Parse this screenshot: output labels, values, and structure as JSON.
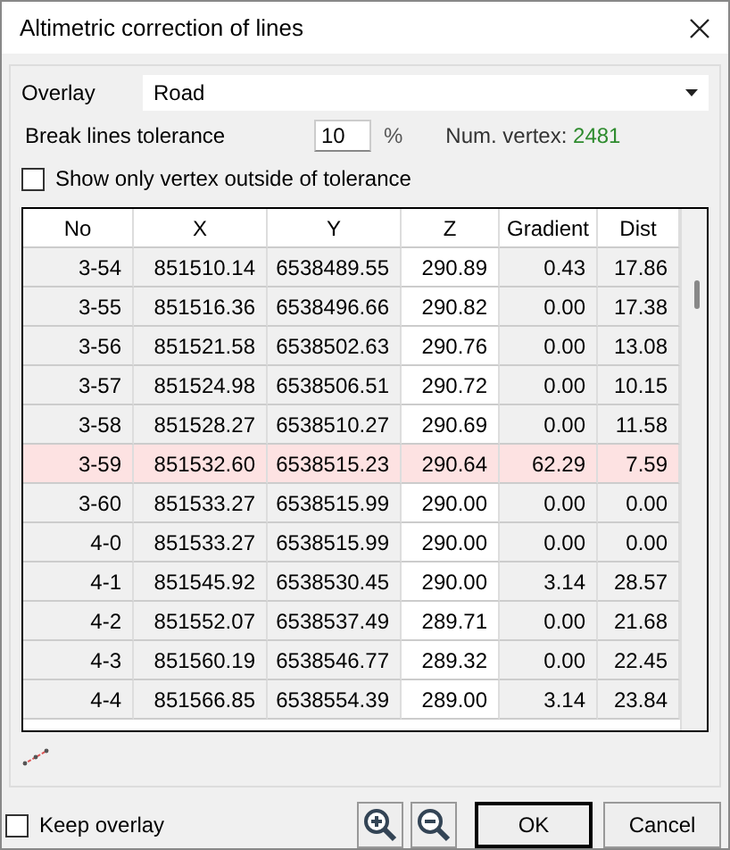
{
  "window": {
    "title": "Altimetric correction of lines"
  },
  "overlay": {
    "label": "Overlay",
    "value": "Road"
  },
  "tolerance": {
    "label": "Break lines tolerance",
    "value": "10",
    "unit": "%"
  },
  "vertex_count": {
    "label": "Num. vertex:",
    "value": "2481"
  },
  "show_outside": {
    "label": "Show only vertex outside of tolerance",
    "checked": false
  },
  "table": {
    "columns": [
      {
        "label": "No",
        "editable": false
      },
      {
        "label": "X",
        "editable": false
      },
      {
        "label": "Y",
        "editable": false
      },
      {
        "label": "Z",
        "editable": true
      },
      {
        "label": "Gradient",
        "editable": false
      },
      {
        "label": "Dist",
        "editable": false
      }
    ],
    "rows": [
      {
        "cells": [
          "3-54",
          "851510.14",
          "6538489.55",
          "290.89",
          "0.43",
          "17.86"
        ],
        "selected": false
      },
      {
        "cells": [
          "3-55",
          "851516.36",
          "6538496.66",
          "290.82",
          "0.00",
          "17.38"
        ],
        "selected": false
      },
      {
        "cells": [
          "3-56",
          "851521.58",
          "6538502.63",
          "290.76",
          "0.00",
          "13.08"
        ],
        "selected": false
      },
      {
        "cells": [
          "3-57",
          "851524.98",
          "6538506.51",
          "290.72",
          "0.00",
          "10.15"
        ],
        "selected": false
      },
      {
        "cells": [
          "3-58",
          "851528.27",
          "6538510.27",
          "290.69",
          "0.00",
          "11.58"
        ],
        "selected": false
      },
      {
        "cells": [
          "3-59",
          "851532.60",
          "6538515.23",
          "290.64",
          "62.29",
          "7.59"
        ],
        "selected": true
      },
      {
        "cells": [
          "3-60",
          "851533.27",
          "6538515.99",
          "290.00",
          "0.00",
          "0.00"
        ],
        "selected": false
      },
      {
        "cells": [
          "4-0",
          "851533.27",
          "6538515.99",
          "290.00",
          "0.00",
          "0.00"
        ],
        "selected": false
      },
      {
        "cells": [
          "4-1",
          "851545.92",
          "6538530.45",
          "290.00",
          "3.14",
          "28.57"
        ],
        "selected": false
      },
      {
        "cells": [
          "4-2",
          "851552.07",
          "6538537.49",
          "289.71",
          "0.00",
          "21.68"
        ],
        "selected": false
      },
      {
        "cells": [
          "4-3",
          "851560.19",
          "6538546.77",
          "289.32",
          "0.00",
          "22.45"
        ],
        "selected": false
      },
      {
        "cells": [
          "4-4",
          "851566.85",
          "6538554.39",
          "289.00",
          "3.14",
          "23.84"
        ],
        "selected": false
      }
    ]
  },
  "keep_overlay": {
    "label": "Keep overlay",
    "checked": false
  },
  "buttons": [
    "OK",
    "Cancel"
  ]
}
